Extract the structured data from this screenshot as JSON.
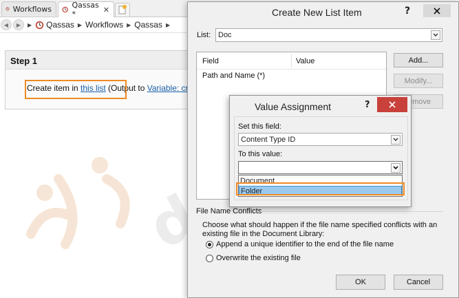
{
  "tabs": [
    {
      "label": "Workflows"
    },
    {
      "label": "Qassas *"
    }
  ],
  "breadcrumb": [
    "Qassas",
    "Workflows",
    "Qassas"
  ],
  "step": {
    "title": "Step 1",
    "action_prefix": "Create item in ",
    "action_link": "this list",
    "action_mid": " (Output to ",
    "action_var": "Variable: cr"
  },
  "create_dialog": {
    "title": "Create New List Item",
    "help": "?",
    "list_label": "List:",
    "list_value": "Doc",
    "col_field": "Field",
    "col_value": "Value",
    "rows": [
      "Path and Name (*)"
    ],
    "add_button": "Add...",
    "modify_button": "Modify...",
    "remove_button": "emove",
    "conflicts_title": "File Name Conflicts",
    "conflicts_desc1": "Choose what should happen if the file name specified conflicts with an",
    "conflicts_desc2": "existing file in the Document Library:",
    "option1": "Append a unique identifier to the end of the file name",
    "option2": "Overwrite the existing file",
    "ok_button": "OK",
    "cancel_button": "Cancel"
  },
  "value_dialog": {
    "title": "Value Assignment",
    "help": "?",
    "field_label": "Set this field:",
    "field_value": "Content Type ID",
    "value_label": "To this value:",
    "value_current": "",
    "options": [
      "Document",
      "Folder"
    ],
    "selected_option": "Folder"
  },
  "colors": {
    "highlight_orange": "#f08a24",
    "link_blue": "#1a5fa8",
    "close_red": "#c8413b",
    "selection_blue": "#99c9ef"
  },
  "watermark": "devworx"
}
